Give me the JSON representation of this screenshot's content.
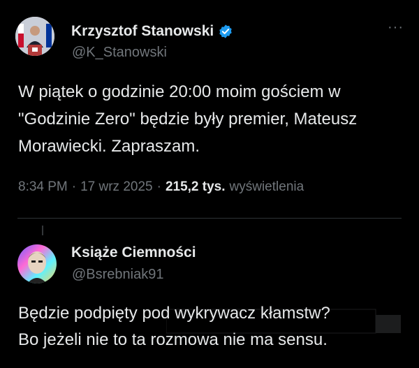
{
  "main_tweet": {
    "author_name": "Krzysztof Stanowski",
    "author_handle": "@K_Stanowski",
    "verified_icon": "verified-badge-icon",
    "text_line1": "W piątek o godzinie 20:00 moim gościem w",
    "text_line2": "\"Godzinie Zero\" będzie były premier, Mateusz",
    "text_line3": "Morawiecki. Zapraszam.",
    "time": "8:34 PM",
    "date": "17 wrz 2025",
    "sep": "·",
    "views_count": "215,2 tys.",
    "views_label": "wyświetlenia",
    "more_label": "···"
  },
  "reply_tweet": {
    "author_name": "Książe Ciemności",
    "author_handle": "@Bsrebniak91",
    "text_line1": "Będzie podpięty pod wykrywacz kłamstw?",
    "text_line2": "Bo jeżeli nie to ta rozmowa nie ma sensu."
  },
  "colors": {
    "background": "#000000",
    "text": "#e7e9ea",
    "muted": "#71767b",
    "verified": "#1d9bf0",
    "divider": "#2f3336"
  }
}
